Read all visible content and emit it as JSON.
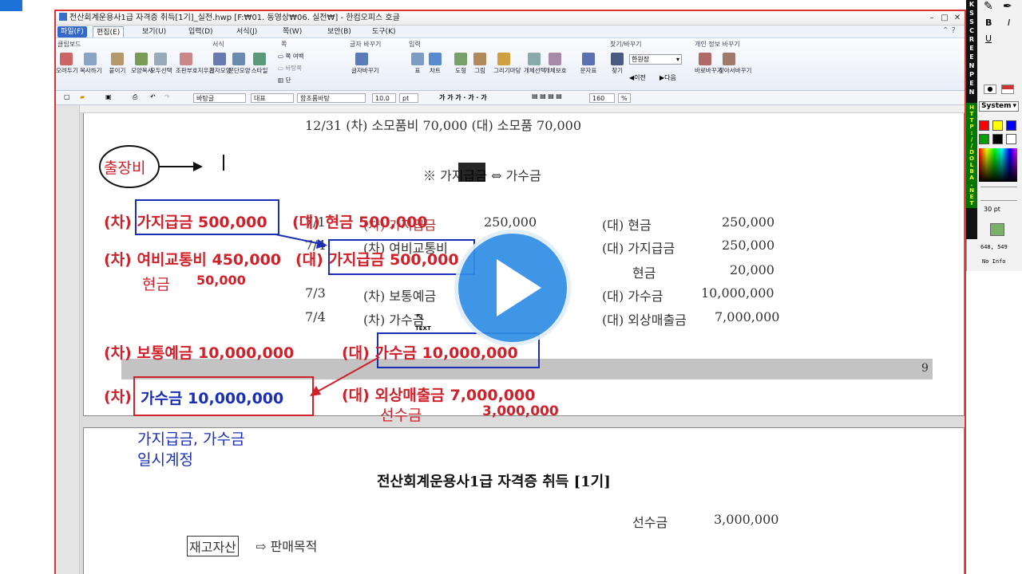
{
  "window": {
    "title": "전산회계운용사1급 자격증 취득[1기]_실전.hwp [F:₩01. 동영상₩06. 실전₩] - 한컴오피스 호글",
    "min": "–",
    "max": "□",
    "close": "✕"
  },
  "menu": [
    "파일(F)",
    "편집(E)",
    "보기(U)",
    "입력(D)",
    "서식(J)",
    "쪽(W)",
    "보안(B)",
    "도구(K)"
  ],
  "ribbon": {
    "groups": [
      "클립보드",
      "서식",
      "쪽",
      "글자 바꾸기",
      "입력",
      "찾기/바꾸기",
      "개인 정보 바꾸기"
    ],
    "buttons": [
      "오려두기",
      "복사하기",
      "붙이기",
      "모양복사",
      "모두선택",
      "조판부호지우기",
      "글자모양",
      "문단모양",
      "스타일",
      "쪽 여백",
      "바탕쪽",
      "단",
      "글자바꾸기",
      "표",
      "차트",
      "도형",
      "그림",
      "그리기마당",
      "개체선택",
      "개체보호",
      "문자표",
      "찾기",
      "바로바꾸기",
      "찾아서바꾸기"
    ],
    "find_select": "한원장",
    "prev": "이전",
    "next": "다음"
  },
  "format_bar": {
    "style": "바탕글",
    "lang": "대표",
    "font": "함초롬바탕",
    "size": "10.0",
    "unit": "pt",
    "zoom": "160",
    "zoom_unit": "%"
  },
  "document": {
    "line_1231": "12/31 (차) 소모품비     70,000       (대) 소모품          70,000",
    "heading_sign": "※ 가지급금 ⇔ 가수금",
    "row1_date": "7/1",
    "row1_dr": "(차) 가지급금",
    "row1_amt": "250,000",
    "row1_cr": "(대) 현금",
    "row1_cramt": "250,000",
    "row2_date": "7/4",
    "row2_dr": "(차) 여비교통비",
    "row2_cr_label": "(대) 가지급금",
    "row2_cramt": "250,000",
    "row2b_cr": "현금",
    "row2b_amt": "20,000",
    "row3_date": "7/3",
    "row3_dr": "(차) 보통예금",
    "row3_cr": "(대) 가수금",
    "row3_amt": "10,000,000",
    "row4_date": "7/4",
    "row4_dr": "(차) 가수금",
    "row4_cr": "(대) 외상매출금",
    "row4_amt": "7,000,000",
    "page_num": "9",
    "page2_title": "전산회계운용사1급 자격증 취득 [1기]",
    "page2_sunsu": "선수금",
    "page2_sunsu_amt": "3,000,000",
    "page2_jaego": "재고자산",
    "page2_arrow": "⇨ 판매목적"
  },
  "annotations": {
    "chuljang": "출장비",
    "a1_dr": "(차) 가지급금 500,000",
    "a1_cr": "(대) 현금 500,000",
    "a2_dr": "(차) 여비교통비 450,000",
    "a2_cr": "(대) 가지급금 500,000",
    "a2_cash": "현금",
    "a2_cash_amt": "50,000",
    "a3_dr": "(차) 보통예금 10,000,000",
    "a3_cr": "(대) 가수금 10,000,000",
    "a4_dr_prefix": "(차)",
    "a4_dr": "가수금 10,000,000",
    "a4_cr": "(대) 외상매출금 7,000,000",
    "a4_cr2": "선수금",
    "a4_cr2_amt": "3,000,000",
    "note1": "가지급금, 가수금",
    "note2": "일시계정",
    "cursor_text": "TEXT"
  },
  "side_panel": {
    "vertical_label": "KSSCREENPEN",
    "url_label": "HTTP://DOLBA.NET",
    "font_select": "System",
    "pen_size": "30 pt",
    "coords": "648, 549",
    "info": "No Info",
    "colors": [
      "#ff0000",
      "#ffff00",
      "#0000ff",
      "#00a000",
      "#000000",
      "#ffffff"
    ]
  }
}
